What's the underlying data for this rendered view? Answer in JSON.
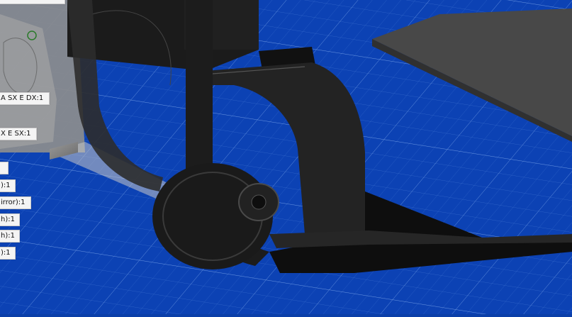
{
  "viewport": {
    "background_color": "#0c42b4",
    "grid_color": "#5b8de0",
    "callouts": [
      {
        "label": "A SX E DX:1"
      },
      {
        "label": "X E SX:1"
      },
      {
        "label": ""
      },
      {
        "label": "):1"
      },
      {
        "label": "irror):1"
      },
      {
        "label": "h):1"
      },
      {
        "label": "h):1"
      },
      {
        "label": "):1"
      }
    ]
  }
}
